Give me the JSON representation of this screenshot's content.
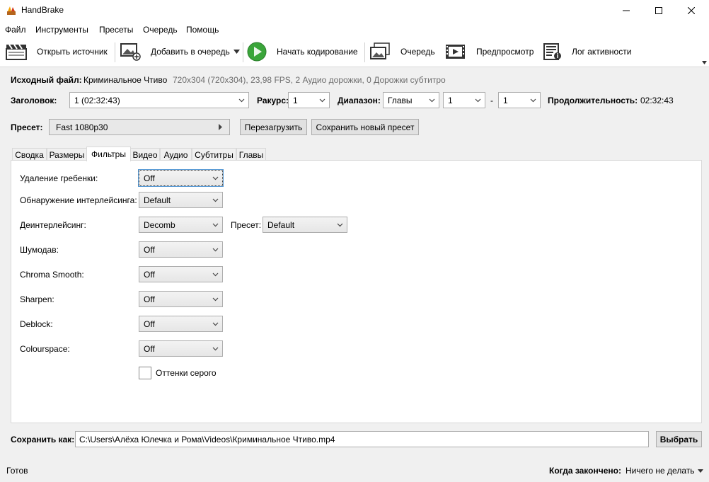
{
  "window": {
    "title": "HandBrake"
  },
  "menu": [
    "Файл",
    "Инструменты",
    "Пресеты",
    "Очередь",
    "Помощь"
  ],
  "toolbar": {
    "open_source": "Открыть источник",
    "add_to_queue": "Добавить в очередь",
    "start_encode": "Начать кодирование",
    "queue": "Очередь",
    "preview": "Предпросмотр",
    "activity_log": "Лог активности"
  },
  "source": {
    "label": "Исходный файл:",
    "name": "Криминальное Чтиво",
    "info": "720x304 (720x304), 23,98 FPS, 2 Аудио дорожки, 0 Дорожки субтитро"
  },
  "title_row": {
    "title_label": "Заголовок:",
    "title_value": "1 (02:32:43)",
    "angle_label": "Ракурс:",
    "angle_value": "1",
    "range_label": "Диапазон:",
    "range_type": "Главы",
    "range_start": "1",
    "range_dash": "-",
    "range_end": "1",
    "duration_label": "Продолжительность:",
    "duration_value": "02:32:43"
  },
  "preset": {
    "label": "Пресет:",
    "value": "Fast 1080p30",
    "reload": "Перезагрузить",
    "save_new": "Сохранить новый пресет"
  },
  "tabs": [
    "Сводка",
    "Размеры",
    "Фильтры",
    "Видео",
    "Аудио",
    "Субтитры",
    "Главы"
  ],
  "active_tab": "Фильтры",
  "filters": {
    "detelecine_label": "Удаление гребенки:",
    "detelecine_value": "Off",
    "interlace_detection_label": "Обнаружение интерлейсинга:",
    "interlace_detection_value": "Default",
    "deinterlace_label": "Деинтерлейсинг:",
    "deinterlace_value": "Decomb",
    "deinterlace_preset_label": "Пресет:",
    "deinterlace_preset_value": "Default",
    "denoise_label": "Шумодав:",
    "denoise_value": "Off",
    "chroma_smooth_label": "Chroma Smooth:",
    "chroma_smooth_value": "Off",
    "sharpen_label": "Sharpen:",
    "sharpen_value": "Off",
    "deblock_label": "Deblock:",
    "deblock_value": "Off",
    "colourspace_label": "Colourspace:",
    "colourspace_value": "Off",
    "grayscale_label": "Оттенки серого",
    "grayscale_checked": false
  },
  "save": {
    "label": "Сохранить как:",
    "path": "C:\\Users\\Алёха Юлечка и Рома\\Videos\\Криминальное Чтиво.mp4",
    "browse": "Выбрать"
  },
  "status": {
    "text": "Готов",
    "when_done_label": "Когда закончено:",
    "when_done_value": "Ничего не делать"
  },
  "colors": {
    "play_green": "#3aa53a",
    "panel_border": "#d9d9d9"
  }
}
